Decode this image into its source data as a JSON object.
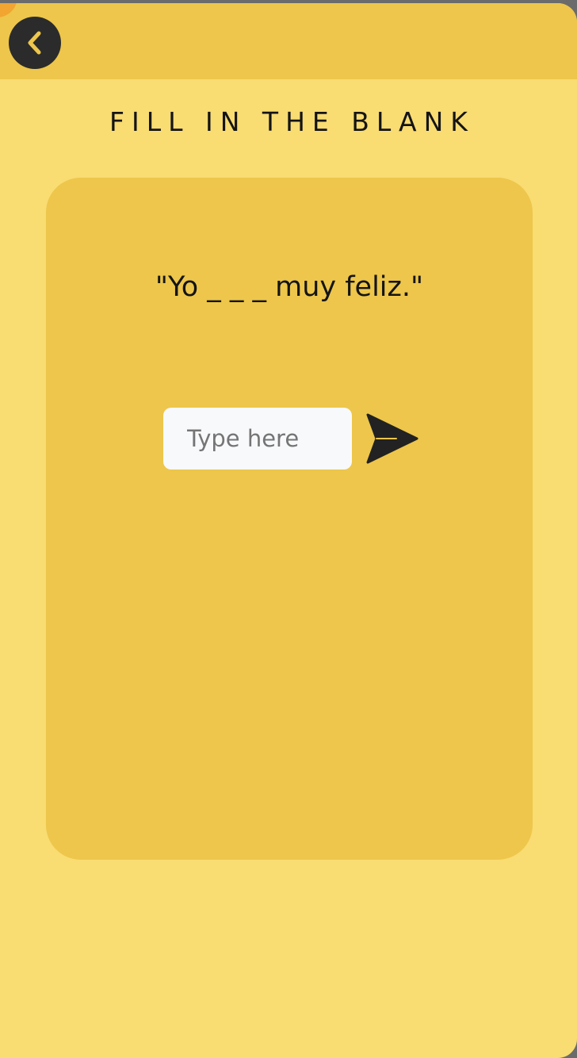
{
  "header": {
    "back_icon": "chevron-left-icon"
  },
  "page": {
    "title": "FILL IN THE BLANK"
  },
  "exercise": {
    "sentence": "\"Yo _ _ _ muy feliz.\"",
    "answer_value": "",
    "answer_placeholder": "Type here",
    "submit_icon": "send-icon"
  },
  "colors": {
    "background": "#f9dc72",
    "header": "#edc64b",
    "card": "#edc64b",
    "back_button": "#2b2b2b",
    "back_chevron": "#edc64b",
    "input_background": "#f8f9fb",
    "text": "#141414",
    "accent_corner": "#f2a531"
  }
}
